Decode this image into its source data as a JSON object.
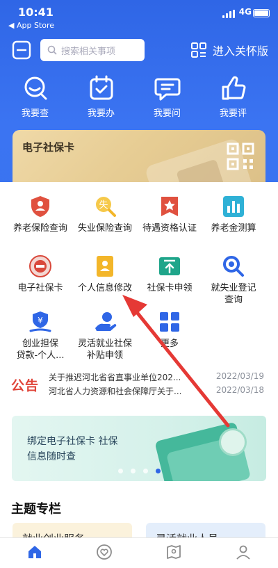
{
  "status_bar": {
    "time": "10:41",
    "back_label": "◀ App Store",
    "network": "4G"
  },
  "search": {
    "placeholder": "搜索相关事项"
  },
  "care_mode": {
    "label": "进入关怀版"
  },
  "quick_actions": [
    {
      "label": "我要查",
      "icon": "search-chat-icon"
    },
    {
      "label": "我要办",
      "icon": "calendar-check-icon"
    },
    {
      "label": "我要问",
      "icon": "chat-bubble-icon"
    },
    {
      "label": "我要评",
      "icon": "thumbs-up-icon"
    }
  ],
  "social_card": {
    "title": "电子社保卡",
    "icon": "qr-code-icon"
  },
  "services": [
    {
      "label": "养老保险查询",
      "icon": "shield-person-icon",
      "color": "#e0513f"
    },
    {
      "label": "失业保险查询",
      "icon": "lose-search-icon",
      "color": "#f3b62a"
    },
    {
      "label": "待遇资格认证",
      "icon": "star-badge-icon",
      "color": "#e0513f"
    },
    {
      "label": "养老金测算",
      "icon": "bar-chart-icon",
      "color": "#2fb1d6"
    },
    {
      "label": "电子社保卡",
      "icon": "seal-emblem-icon",
      "color": "#d9483b"
    },
    {
      "label": "个人信息修改",
      "icon": "id-card-icon",
      "color": "#f3b62a"
    },
    {
      "label": "社保卡申领",
      "icon": "upload-card-icon",
      "color": "#1fa58a"
    },
    {
      "label": "就失业登记",
      "label2": "查询",
      "icon": "magnifier-icon",
      "color": "#2f66e6"
    },
    {
      "label": "创业担保",
      "label2": "贷款-个人...",
      "icon": "yen-hand-icon",
      "color": "#2f66e6"
    },
    {
      "label": "灵活就业社保",
      "label2": "补贴申领",
      "icon": "hand-coin-icon",
      "color": "#2f66e6"
    },
    {
      "label": "更多",
      "icon": "grid-more-icon",
      "color": "#2f66e6"
    }
  ],
  "notice": {
    "logo": "公告",
    "items": [
      {
        "title": "关于推迟河北省省直事业单位202...",
        "date": "2022/03/19"
      },
      {
        "title": "河北省人力资源和社会保障厅关于...",
        "date": "2022/03/18"
      }
    ]
  },
  "banner": {
    "line1": "绑定电子社保卡 社保",
    "line2": "信息随时查",
    "page_count": 4,
    "active_page": 4
  },
  "section_title": "主题专栏",
  "topics": [
    {
      "label": "就业创业服务"
    },
    {
      "label": "灵活就业人员"
    }
  ],
  "tabbar": [
    {
      "icon": "home-icon",
      "color": "#2f66e6"
    },
    {
      "icon": "heart-icon",
      "color": "#8c8c8c"
    },
    {
      "icon": "map-icon",
      "color": "#8c8c8c"
    },
    {
      "icon": "person-icon",
      "color": "#8c8c8c"
    }
  ],
  "colors": {
    "brand": "#2f66e6",
    "annotation_arrow": "#e53935"
  }
}
